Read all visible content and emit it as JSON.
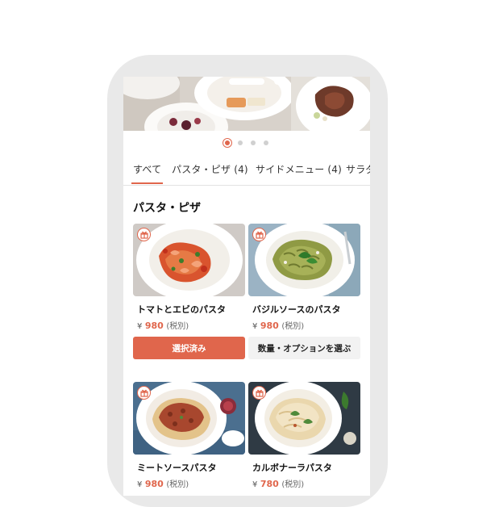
{
  "tabs": [
    {
      "label": "すべて",
      "active": true
    },
    {
      "label": "パスタ・ピザ (4)",
      "active": false
    },
    {
      "label": "サイドメニュー (4)",
      "active": false
    },
    {
      "label": "サラダ",
      "active": false
    }
  ],
  "carousel": {
    "page_count": 4,
    "active_index": 0
  },
  "section": {
    "title": "パスタ・ピザ"
  },
  "items": [
    {
      "name": "トマトとエビのパスタ",
      "currency": "¥",
      "price": "980",
      "tax": "(税別)",
      "button": "選択済み",
      "selected": true,
      "gift_icon": "gift-icon"
    },
    {
      "name": "バジルソースのパスタ",
      "currency": "¥",
      "price": "980",
      "tax": "(税別)",
      "button": "数量・オプションを選ぶ",
      "selected": false,
      "gift_icon": "gift-icon"
    },
    {
      "name": "ミートソースパスタ",
      "currency": "¥",
      "price": "980",
      "tax": "(税別)",
      "gift_icon": "gift-icon"
    },
    {
      "name": "カルボナーラパスタ",
      "currency": "¥",
      "price": "780",
      "tax": "(税別)",
      "gift_icon": "gift-icon"
    }
  ],
  "colors": {
    "accent": "#e0664c",
    "frame": "#e9e9e9",
    "secondary_button": "#f2f2f2"
  }
}
